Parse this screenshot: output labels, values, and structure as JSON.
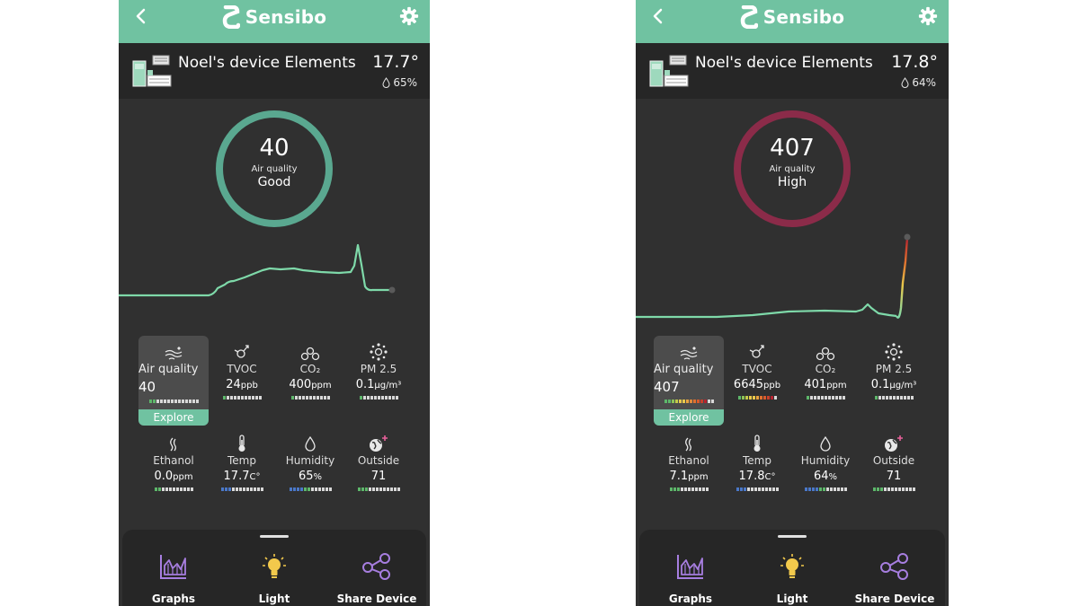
{
  "colors": {
    "header": "#70c2a1",
    "ring_good": "#5aa890",
    "ring_high": "#8b2b49",
    "graph_line": "#7ed9a9",
    "nav_icon": "#a77ee0",
    "light_icon": "#f2c94c"
  },
  "screens": [
    {
      "header": {
        "brand": "Sensibo",
        "back_icon": "chevron-left-icon",
        "settings_icon": "gear-icon"
      },
      "device": {
        "name": "Noel's device Elements",
        "temperature": "17.7°",
        "humidity": "65%"
      },
      "air_quality": {
        "value": "40",
        "label": "Air quality",
        "status": "Good",
        "ring_color": "#5aa890"
      },
      "tiles": [
        {
          "label": "Air quality",
          "value": "40",
          "unit": "",
          "explore": "Explore",
          "icon": "air-quality-icon"
        },
        {
          "label": "TVOC",
          "value": "24",
          "unit": "ppb",
          "icon": "tvoc-icon"
        },
        {
          "label": "CO₂",
          "value": "400",
          "unit": "ppm",
          "icon": "co2-icon"
        },
        {
          "label": "PM 2.5",
          "value": "0.1",
          "unit": "µg/m³",
          "icon": "pm25-icon"
        },
        {
          "label": "Ethanol",
          "value": "0.0",
          "unit": "ppm",
          "icon": "ethanol-icon"
        },
        {
          "label": "Temp",
          "value": "17.7",
          "unit": "C°",
          "icon": "thermometer-icon"
        },
        {
          "label": "Humidity",
          "value": "65",
          "unit": "%",
          "icon": "droplet-icon"
        },
        {
          "label": "Outside",
          "value": "71",
          "unit": "",
          "icon": "globe-plus-icon"
        }
      ],
      "nav": [
        {
          "label": "Graphs",
          "icon": "graphs-icon"
        },
        {
          "label": "Light",
          "icon": "light-bulb-icon"
        },
        {
          "label": "Share Device",
          "icon": "share-icon"
        }
      ]
    },
    {
      "header": {
        "brand": "Sensibo",
        "back_icon": "chevron-left-icon",
        "settings_icon": "gear-icon"
      },
      "device": {
        "name": "Noel's device Elements",
        "temperature": "17.8°",
        "humidity": "64%"
      },
      "air_quality": {
        "value": "407",
        "label": "Air quality",
        "status": "High",
        "ring_color": "#8b2b49"
      },
      "tiles": [
        {
          "label": "Air quality",
          "value": "407",
          "unit": "",
          "explore": "Explore",
          "icon": "air-quality-icon"
        },
        {
          "label": "TVOC",
          "value": "6645",
          "unit": "ppb",
          "icon": "tvoc-icon"
        },
        {
          "label": "CO₂",
          "value": "401",
          "unit": "ppm",
          "icon": "co2-icon"
        },
        {
          "label": "PM 2.5",
          "value": "0.1",
          "unit": "µg/m³",
          "icon": "pm25-icon"
        },
        {
          "label": "Ethanol",
          "value": "7.1",
          "unit": "ppm",
          "icon": "ethanol-icon"
        },
        {
          "label": "Temp",
          "value": "17.8",
          "unit": "C°",
          "icon": "thermometer-icon"
        },
        {
          "label": "Humidity",
          "value": "64",
          "unit": "%",
          "icon": "droplet-icon"
        },
        {
          "label": "Outside",
          "value": "71",
          "unit": "",
          "icon": "globe-plus-icon"
        }
      ],
      "nav": [
        {
          "label": "Graphs",
          "icon": "graphs-icon"
        },
        {
          "label": "Light",
          "icon": "light-bulb-icon"
        },
        {
          "label": "Share Device",
          "icon": "share-icon"
        }
      ]
    }
  ]
}
